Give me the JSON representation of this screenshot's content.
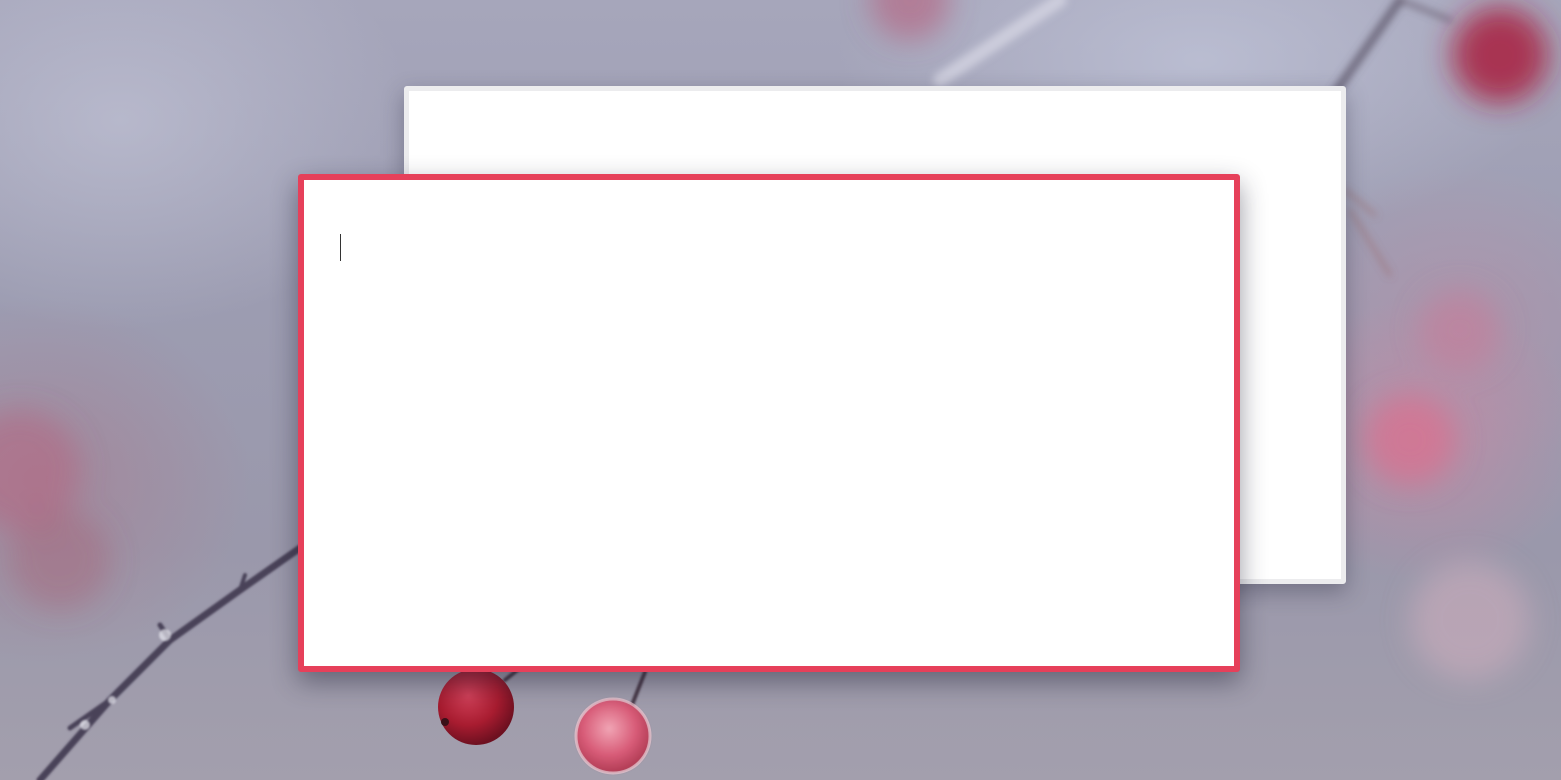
{
  "windows": {
    "back_note": {
      "text": "",
      "focused": false
    },
    "front_note": {
      "text": "",
      "focused": true,
      "accent_color": "#e6405a"
    }
  },
  "wallpaper": {
    "icon": "wallpaper-berries-image"
  }
}
